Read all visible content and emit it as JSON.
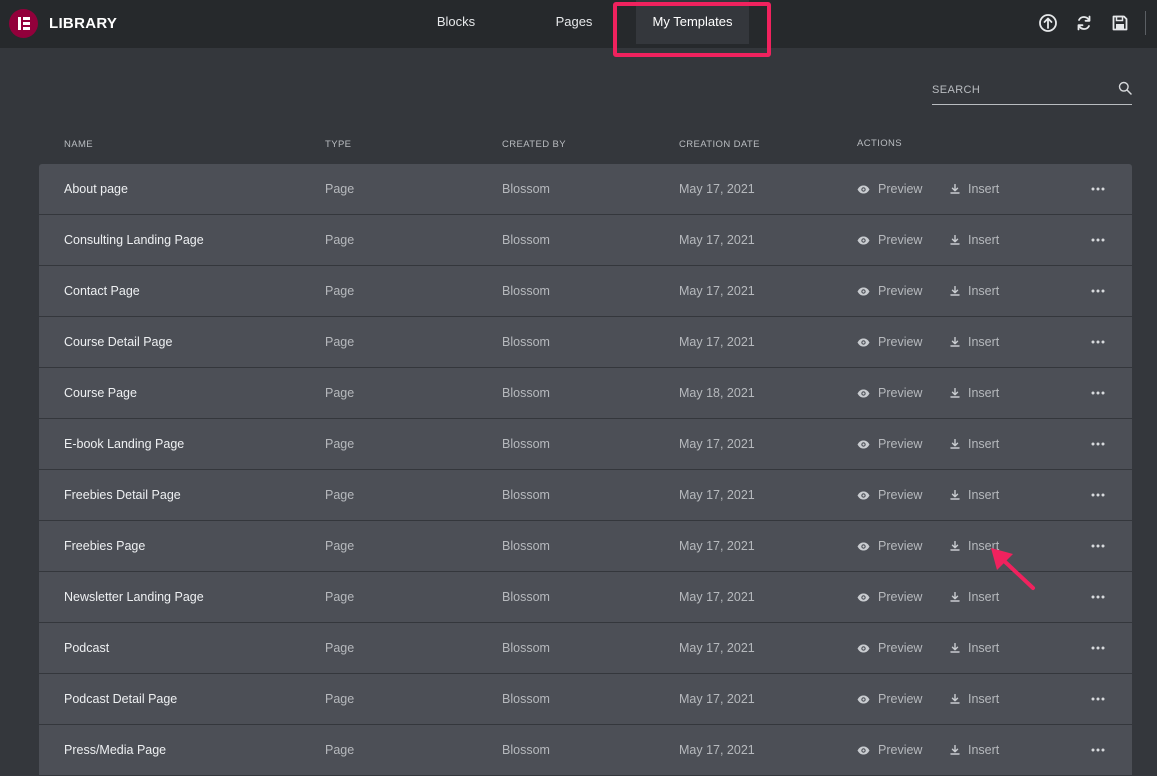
{
  "header": {
    "title": "LIBRARY",
    "tabs": [
      {
        "label": "Blocks"
      },
      {
        "label": "Pages"
      },
      {
        "label": "My Templates",
        "active": true
      }
    ],
    "icons": [
      "upload-icon",
      "sync-icon",
      "save-icon"
    ]
  },
  "search": {
    "placeholder": "SEARCH"
  },
  "columns": {
    "name": "NAME",
    "type": "TYPE",
    "created_by": "CREATED BY",
    "creation_date": "CREATION DATE",
    "actions": "ACTIONS"
  },
  "actions": {
    "preview_label": "Preview",
    "insert_label": "Insert"
  },
  "rows": [
    {
      "name": "About page",
      "type": "Page",
      "created_by": "Blossom",
      "date": "May 17, 2021"
    },
    {
      "name": "Consulting Landing Page",
      "type": "Page",
      "created_by": "Blossom",
      "date": "May 17, 2021"
    },
    {
      "name": "Contact Page",
      "type": "Page",
      "created_by": "Blossom",
      "date": "May 17, 2021"
    },
    {
      "name": "Course Detail Page",
      "type": "Page",
      "created_by": "Blossom",
      "date": "May 17, 2021"
    },
    {
      "name": "Course Page",
      "type": "Page",
      "created_by": "Blossom",
      "date": "May 18, 2021"
    },
    {
      "name": "E-book Landing Page",
      "type": "Page",
      "created_by": "Blossom",
      "date": "May 17, 2021"
    },
    {
      "name": "Freebies Detail Page",
      "type": "Page",
      "created_by": "Blossom",
      "date": "May 17, 2021"
    },
    {
      "name": "Freebies Page",
      "type": "Page",
      "created_by": "Blossom",
      "date": "May 17, 2021"
    },
    {
      "name": "Newsletter Landing Page",
      "type": "Page",
      "created_by": "Blossom",
      "date": "May 17, 2021"
    },
    {
      "name": "Podcast",
      "type": "Page",
      "created_by": "Blossom",
      "date": "May 17, 2021"
    },
    {
      "name": "Podcast Detail Page",
      "type": "Page",
      "created_by": "Blossom",
      "date": "May 17, 2021"
    },
    {
      "name": "Press/Media Page",
      "type": "Page",
      "created_by": "Blossom",
      "date": "May 17, 2021"
    }
  ],
  "colors": {
    "brand": "#92003b",
    "annotation": "#f0225e",
    "header_bg": "#26292c",
    "page_bg": "#34373c",
    "row_bg": "#4c4f56"
  }
}
